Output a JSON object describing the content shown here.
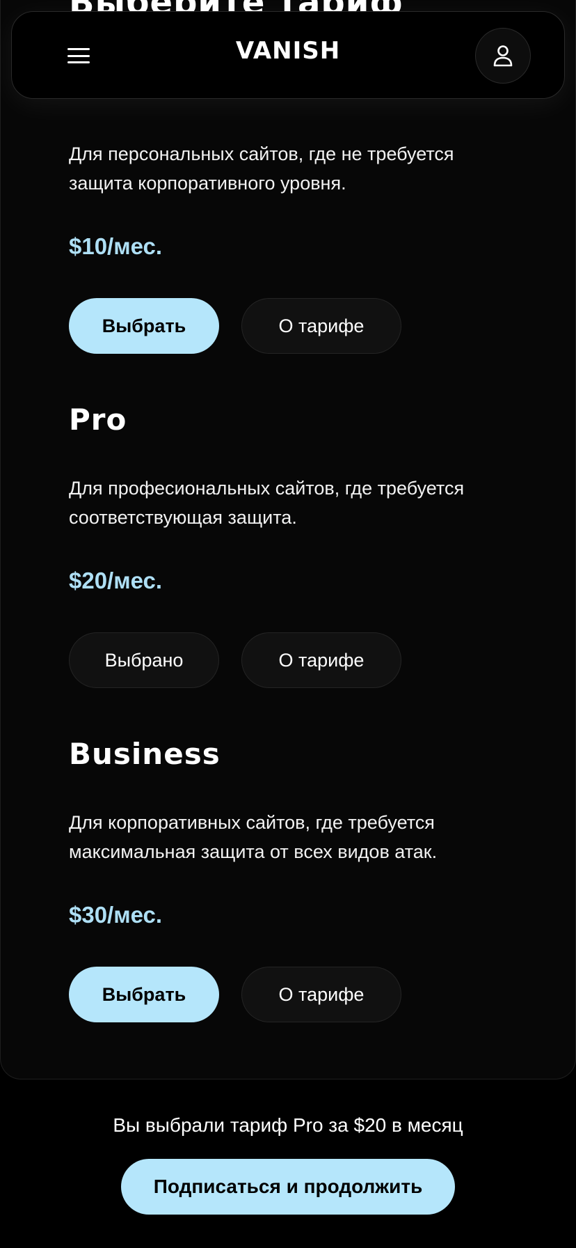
{
  "page": {
    "title": "Выберите тариф"
  },
  "header": {
    "logo": "VANISH",
    "menu_icon": "hamburger-menu-icon",
    "profile_icon": "user-icon"
  },
  "plans": [
    {
      "name": "",
      "description_line1": "Для персональных сайтов, где не требуется",
      "description_line2": "защита корпоративного уровня.",
      "price": "$10/мес.",
      "select_label": "Выбрать",
      "about_label": "О тарифе"
    },
    {
      "name": "Pro",
      "description_line1": "Для професиональных сайтов, где требуется",
      "description_line2": "соответствующая защита.",
      "price": "$20/мес.",
      "select_label": "Выбрано",
      "about_label": "О тарифе"
    },
    {
      "name": "Business",
      "description_line1": "Для корпоративных сайтов, где требуется",
      "description_line2": "максимальная защита от всех видов атак.",
      "price": "$30/мес.",
      "select_label": "Выбрать",
      "about_label": "О тарифе"
    }
  ],
  "footer": {
    "summary": "Вы выбрали тариф Pro за $20 в месяц",
    "cta_label": "Подписаться и продолжить"
  },
  "colors": {
    "accent": "#b5e6fb",
    "price": "#aedff5",
    "background": "#000000"
  }
}
